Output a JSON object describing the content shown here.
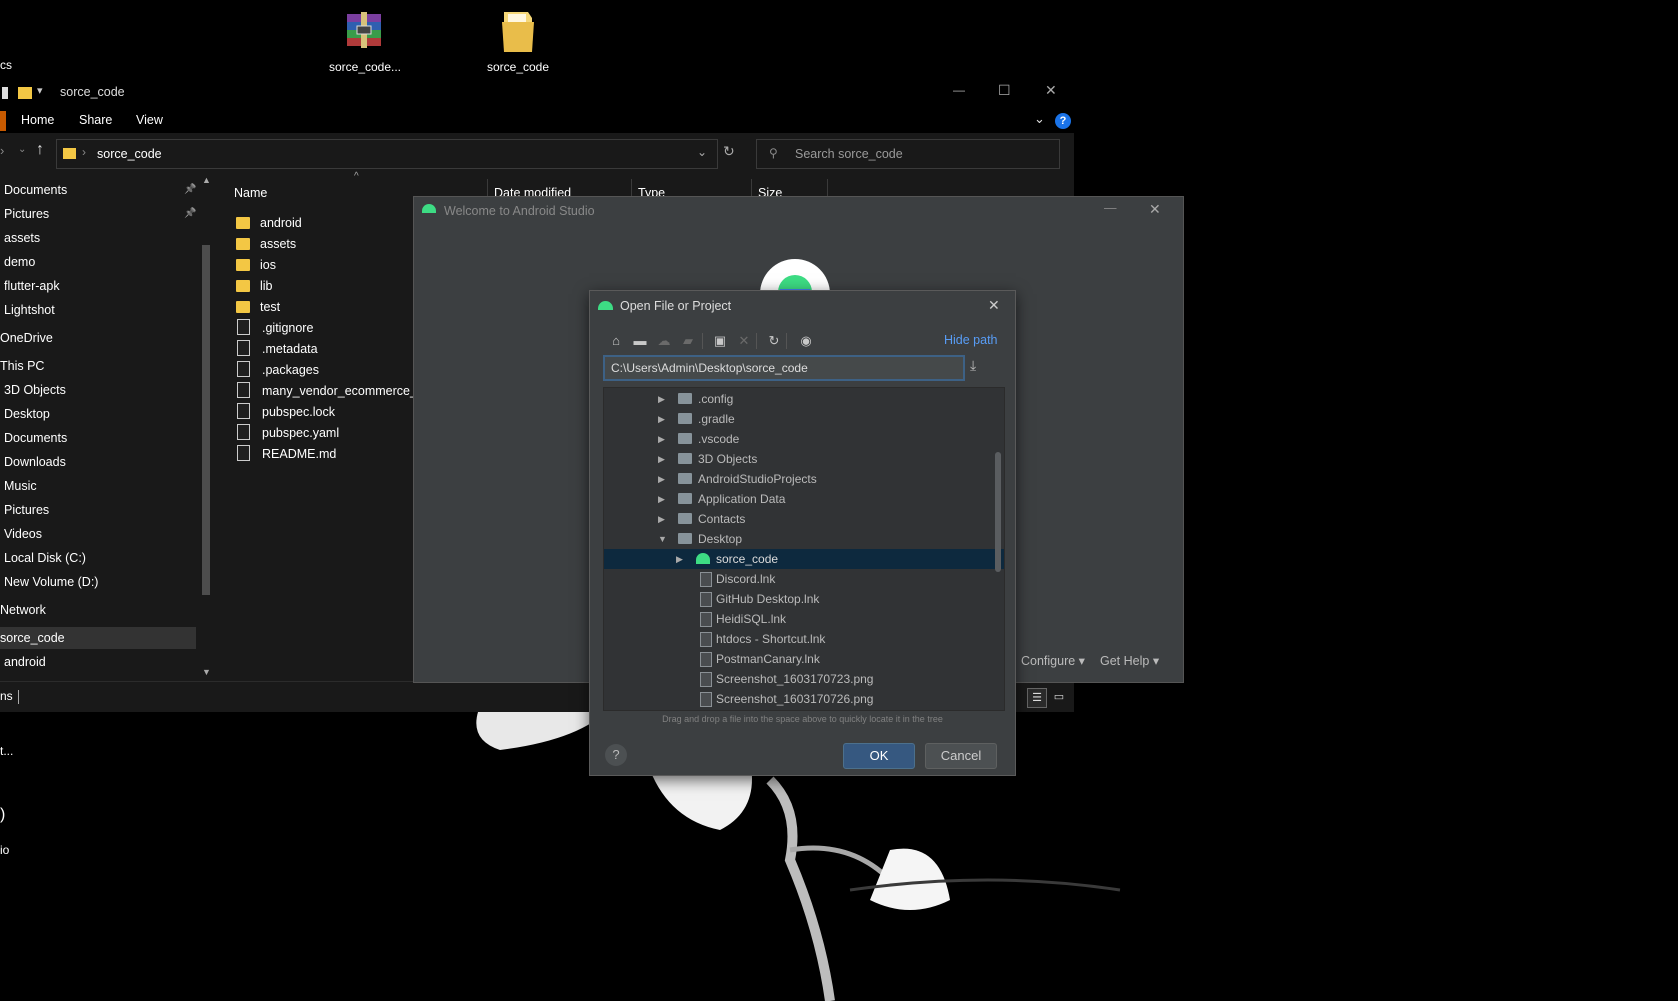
{
  "desktop": {
    "icons": [
      {
        "label": "sorce_code...",
        "icon": "winrar-archive-icon"
      },
      {
        "label": "sorce_code",
        "icon": "folder-icon"
      }
    ],
    "left_labels": [
      "cs",
      "t...",
      ")",
      "io"
    ]
  },
  "explorer": {
    "title": "sorce_code",
    "window_controls": {
      "minimize": "—",
      "maximize": "☐",
      "close": "✕"
    },
    "ribbon_tabs": [
      "Home",
      "Share",
      "View"
    ],
    "address": {
      "crumb": "sorce_code",
      "search_placeholder": "Search sorce_code"
    },
    "nav_items": [
      {
        "label": "Documents",
        "pinned": true
      },
      {
        "label": "Pictures",
        "pinned": true
      },
      {
        "label": "assets"
      },
      {
        "label": "demo"
      },
      {
        "label": "flutter-apk"
      },
      {
        "label": "Lightshot"
      },
      {
        "label": "OneDrive"
      },
      {
        "label": "This PC"
      },
      {
        "label": "3D Objects"
      },
      {
        "label": "Desktop"
      },
      {
        "label": "Documents"
      },
      {
        "label": "Downloads"
      },
      {
        "label": "Music"
      },
      {
        "label": "Pictures"
      },
      {
        "label": "Videos"
      },
      {
        "label": "Local Disk (C:)"
      },
      {
        "label": "New Volume (D:)"
      },
      {
        "label": "Network"
      },
      {
        "label": "sorce_code"
      },
      {
        "label": "android"
      }
    ],
    "columns": [
      "Name",
      "Date modified",
      "Type",
      "Size"
    ],
    "files": [
      {
        "name": "android",
        "kind": "folder"
      },
      {
        "name": "assets",
        "kind": "folder"
      },
      {
        "name": "ios",
        "kind": "folder"
      },
      {
        "name": "lib",
        "kind": "folder"
      },
      {
        "name": "test",
        "kind": "folder"
      },
      {
        "name": ".gitignore",
        "kind": "file"
      },
      {
        "name": ".metadata",
        "kind": "file"
      },
      {
        "name": ".packages",
        "kind": "file"
      },
      {
        "name": "many_vendor_ecommerce_ap",
        "kind": "file"
      },
      {
        "name": "pubspec.lock",
        "kind": "file"
      },
      {
        "name": "pubspec.yaml",
        "kind": "file"
      },
      {
        "name": "README.md",
        "kind": "file"
      }
    ],
    "status_text": "ns"
  },
  "android_studio": {
    "title": "Welcome to Android Studio",
    "configure": "Configure",
    "get_help": "Get Help"
  },
  "dialog": {
    "title": "Open File or Project",
    "hide_path": "Hide path",
    "path_value": "C:\\Users\\Admin\\Desktop\\sorce_code",
    "tree": [
      {
        "label": ".config",
        "type": "folder",
        "expand": "collapsed",
        "level": 1
      },
      {
        "label": ".gradle",
        "type": "folder",
        "expand": "collapsed",
        "level": 1
      },
      {
        "label": ".vscode",
        "type": "folder",
        "expand": "collapsed",
        "level": 1
      },
      {
        "label": "3D Objects",
        "type": "folder",
        "expand": "collapsed",
        "level": 1
      },
      {
        "label": "AndroidStudioProjects",
        "type": "folder",
        "expand": "collapsed",
        "level": 1
      },
      {
        "label": "Application Data",
        "type": "folder",
        "expand": "collapsed",
        "level": 1
      },
      {
        "label": "Contacts",
        "type": "folder",
        "expand": "collapsed",
        "level": 1
      },
      {
        "label": "Desktop",
        "type": "folder",
        "expand": "expanded",
        "level": 1
      },
      {
        "label": "sorce_code",
        "type": "android",
        "expand": "collapsed",
        "level": 2,
        "selected": true
      },
      {
        "label": "Discord.lnk",
        "type": "file",
        "level": 2
      },
      {
        "label": "GitHub Desktop.lnk",
        "type": "file",
        "level": 2
      },
      {
        "label": "HeidiSQL.lnk",
        "type": "file",
        "level": 2
      },
      {
        "label": "htdocs - Shortcut.lnk",
        "type": "file",
        "level": 2
      },
      {
        "label": "PostmanCanary.lnk",
        "type": "file",
        "level": 2
      },
      {
        "label": "Screenshot_1603170723.png",
        "type": "file",
        "level": 2
      },
      {
        "label": "Screenshot_1603170726.png",
        "type": "file",
        "level": 2
      }
    ],
    "hint": "Drag and drop a file into the space above to quickly locate it in the tree",
    "ok": "OK",
    "cancel": "Cancel",
    "help": "?"
  },
  "colors": {
    "selection": "#0d293e",
    "ok_button": "#365880",
    "dialog_bg": "#3c3f41",
    "android_green": "#3ddc84",
    "link_blue": "#589df6"
  }
}
